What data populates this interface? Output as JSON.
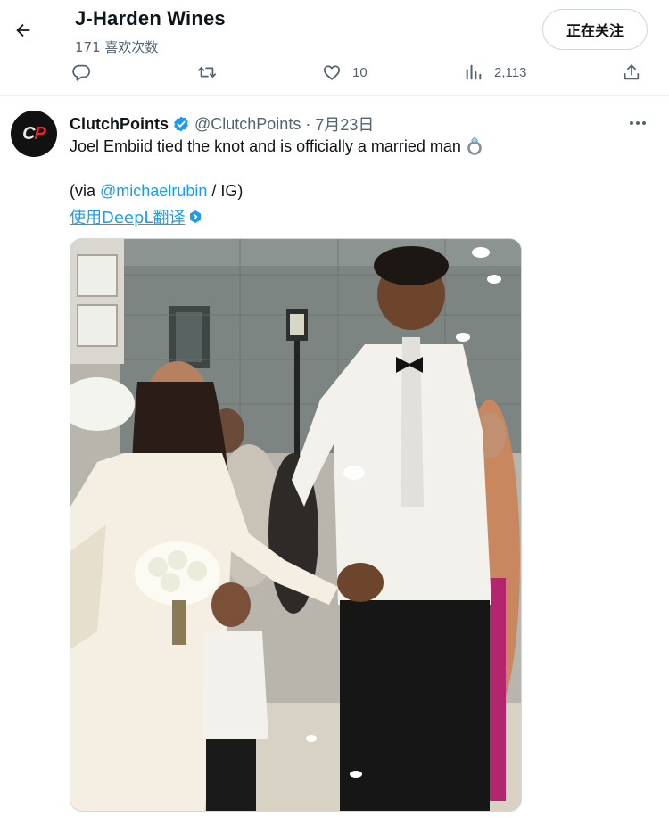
{
  "header": {
    "title": "J-Harden Wines",
    "likes_count": "171 喜欢次数",
    "follow_label": "正在关注"
  },
  "actions": {
    "like_count": "10",
    "views_count": "2,113"
  },
  "tweet": {
    "display_name": "ClutchPoints",
    "handle": "@ClutchPoints",
    "separator": "·",
    "date": "7月23日",
    "text": "Joel Embiid tied the knot and is officially a married man",
    "via_prefix": "(via ",
    "via_mention": "@michaelrubin",
    "via_suffix": " / IG)",
    "translate_label": "使用DeepL翻译"
  },
  "colors": {
    "accent": "#1d9bf0",
    "secondary_text": "#536471",
    "border": "#eff3f4",
    "avatar_red": "#e5262d"
  },
  "icons": [
    "back-arrow-icon",
    "reply-icon",
    "retweet-icon",
    "like-icon",
    "views-icon",
    "share-icon",
    "verified-badge-icon",
    "more-icon",
    "ring-emoji-icon",
    "deepl-icon"
  ]
}
